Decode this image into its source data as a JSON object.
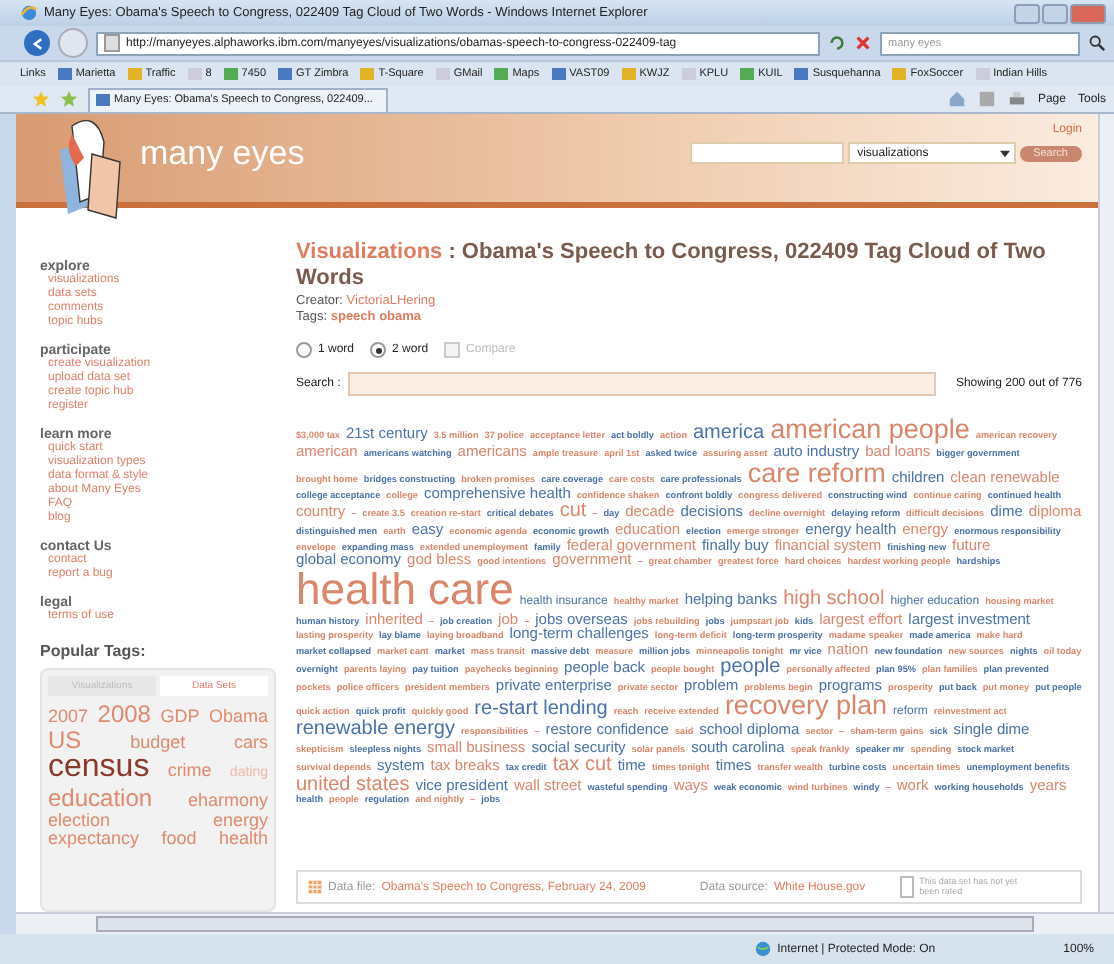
{
  "window": {
    "title": "Many Eyes: Obama's Speech to Congress, 022409 Tag Cloud of Two Words - Windows Internet Explorer"
  },
  "address_bar": {
    "url": "http://manyeyes.alphaworks.ibm.com/manyeyes/visualizations/obamas-speech-to-congress-022409-tag",
    "search_value": "many eyes"
  },
  "links_bar": {
    "label": "Links",
    "items": [
      "Marietta",
      "Traffic",
      "8",
      "7450",
      "GT Zimbra",
      "T-Square",
      "GMail",
      "Maps",
      "VAST09",
      "KWJZ",
      "KPLU",
      "KUIL",
      "Susquehanna",
      "FoxSoccer",
      "Indian Hills"
    ]
  },
  "tab": {
    "title": "Many Eyes: Obama's Speech to Congress, 022409..."
  },
  "commands": [
    "Page",
    "Tools"
  ],
  "site": {
    "name": "many eyes",
    "login": "Login",
    "search_scope": "visualizations",
    "search_button": "Search"
  },
  "sidebar": [
    {
      "heading": "explore",
      "items": [
        "visualizations",
        "data sets",
        "comments",
        "topic hubs"
      ]
    },
    {
      "heading": "participate",
      "items": [
        "create visualization",
        "upload data set",
        "create topic hub",
        "register"
      ]
    },
    {
      "heading": "learn more",
      "items": [
        "quick start",
        "visualization types",
        "data format & style",
        "about Many Eyes",
        "FAQ",
        "blog"
      ]
    },
    {
      "heading": "contact Us",
      "items": [
        "contact",
        "report a bug"
      ]
    },
    {
      "heading": "legal",
      "items": [
        "terms of use"
      ]
    }
  ],
  "popular_tags": {
    "title": "Popular Tags:",
    "tabs": [
      {
        "label": "Visualizations",
        "selected": false
      },
      {
        "label": "Data Sets",
        "selected": true
      }
    ],
    "tags": [
      {
        "text": "2007",
        "kind": "medium"
      },
      {
        "text": "2008",
        "kind": "large"
      },
      {
        "text": "GDP",
        "kind": "medium"
      },
      {
        "text": "Obama",
        "kind": "medium"
      },
      {
        "text": "US",
        "kind": "large"
      },
      {
        "text": "budget",
        "kind": "medium"
      },
      {
        "text": "cars",
        "kind": "medium"
      },
      {
        "text": "census",
        "kind": "huge"
      },
      {
        "text": "crime",
        "kind": "medium"
      },
      {
        "text": "dating",
        "kind": "small"
      },
      {
        "text": "education",
        "kind": "large"
      },
      {
        "text": "eharmony",
        "kind": "medium"
      },
      {
        "text": "election",
        "kind": "medium"
      },
      {
        "text": "energy",
        "kind": "medium"
      },
      {
        "text": "expectancy",
        "kind": "medium"
      },
      {
        "text": "food",
        "kind": "medium"
      },
      {
        "text": "health",
        "kind": "medium"
      }
    ]
  },
  "main": {
    "section": "Visualizations",
    "title": ": Obama's Speech to Congress, 022409 Tag Cloud of Two Words",
    "creator_label": "Creator:",
    "creator": "VictoriaLHering",
    "tags_label": "Tags:",
    "tags": "speech obama",
    "options": [
      {
        "label": "1 word",
        "kind": "radio",
        "selected": false
      },
      {
        "label": "2 word",
        "kind": "radio",
        "selected": true
      },
      {
        "label": "Compare",
        "kind": "checkbox",
        "selected": false,
        "disabled": true
      }
    ],
    "search_label": "Search :",
    "showing": "Showing 200 out of 776",
    "cloud": [
      {
        "text": "$3,000 tax",
        "kind": "tiny",
        "color": "#d9866a"
      },
      {
        "text": "21st century",
        "kind": "medium",
        "color": "#4a72a8"
      },
      {
        "text": "3.5 million",
        "kind": "tiny",
        "color": "#d9866a"
      },
      {
        "text": "37 police",
        "kind": "tiny",
        "color": "#d9866a"
      },
      {
        "text": "acceptance letter",
        "kind": "tiny",
        "color": "#d9866a"
      },
      {
        "text": "act boldly",
        "kind": "tiny",
        "color": "#4a72a8"
      },
      {
        "text": "action",
        "kind": "tiny",
        "color": "#d9866a"
      },
      {
        "text": "america",
        "kind": "large",
        "color": "#4a72a8"
      },
      {
        "text": "american people",
        "kind": "huge",
        "color": "#d9866a"
      },
      {
        "text": "american recovery",
        "kind": "tiny",
        "color": "#d9866a"
      },
      {
        "text": "american",
        "kind": "medium",
        "color": "#d9866a"
      },
      {
        "text": "americans watching",
        "kind": "tiny",
        "color": "#4a72a8"
      },
      {
        "text": "americans",
        "kind": "medium",
        "color": "#d9866a"
      },
      {
        "text": "ample treasure",
        "kind": "tiny",
        "color": "#d9866a"
      },
      {
        "text": "april 1st",
        "kind": "tiny",
        "color": "#d9866a"
      },
      {
        "text": "asked twice",
        "kind": "tiny",
        "color": "#4a72a8"
      },
      {
        "text": "assuring asset",
        "kind": "tiny",
        "color": "#d9866a"
      },
      {
        "text": "auto industry",
        "kind": "medium",
        "color": "#4a72a8"
      },
      {
        "text": "bad loans",
        "kind": "medium",
        "color": "#d9866a"
      },
      {
        "text": "bigger government",
        "kind": "tiny",
        "color": "#4a72a8"
      },
      {
        "text": "brought home",
        "kind": "tiny",
        "color": "#d9866a"
      },
      {
        "text": "bridges constructing",
        "kind": "tiny",
        "color": "#4a72a8"
      },
      {
        "text": "broken promises",
        "kind": "tiny",
        "color": "#d9866a"
      },
      {
        "text": "care coverage",
        "kind": "tiny",
        "color": "#4a72a8"
      },
      {
        "text": "care costs",
        "kind": "tiny",
        "color": "#d9866a"
      },
      {
        "text": "care professionals",
        "kind": "tiny",
        "color": "#4a72a8"
      },
      {
        "text": "care reform",
        "kind": "huge",
        "color": "#d9866a"
      },
      {
        "text": "children",
        "kind": "medium",
        "color": "#4a72a8"
      },
      {
        "text": "clean renewable",
        "kind": "medium",
        "color": "#d9866a"
      },
      {
        "text": "college acceptance",
        "kind": "tiny",
        "color": "#4a72a8"
      },
      {
        "text": "college",
        "kind": "tiny",
        "color": "#d9866a"
      },
      {
        "text": "comprehensive health",
        "kind": "medium",
        "color": "#4a72a8"
      },
      {
        "text": "confidence shaken",
        "kind": "tiny",
        "color": "#d9866a"
      },
      {
        "text": "confront boldly",
        "kind": "tiny",
        "color": "#4a72a8"
      },
      {
        "text": "congress delivered",
        "kind": "tiny",
        "color": "#d9866a"
      },
      {
        "text": "constructing wind",
        "kind": "tiny",
        "color": "#4a72a8"
      },
      {
        "text": "continue caring",
        "kind": "tiny",
        "color": "#d9866a"
      },
      {
        "text": "continued health",
        "kind": "tiny",
        "color": "#4a72a8"
      },
      {
        "text": "country",
        "kind": "medium",
        "color": "#d9866a"
      },
      {
        "text": "–",
        "kind": "tiny",
        "color": "#d9866a"
      },
      {
        "text": "create 3.5",
        "kind": "tiny",
        "color": "#d9866a"
      },
      {
        "text": "creation re-start",
        "kind": "tiny",
        "color": "#d9866a"
      },
      {
        "text": "critical debates",
        "kind": "tiny",
        "color": "#4a72a8"
      },
      {
        "text": "cut",
        "kind": "large",
        "color": "#d9866a"
      },
      {
        "text": "–",
        "kind": "tiny",
        "color": "#d9866a"
      },
      {
        "text": "day",
        "kind": "tiny",
        "color": "#4a72a8"
      },
      {
        "text": "decade",
        "kind": "medium",
        "color": "#d9866a"
      },
      {
        "text": "decisions",
        "kind": "medium",
        "color": "#4a72a8"
      },
      {
        "text": "decline overnight",
        "kind": "tiny",
        "color": "#d9866a"
      },
      {
        "text": "delaying reform",
        "kind": "tiny",
        "color": "#4a72a8"
      },
      {
        "text": "difficult decisions",
        "kind": "tiny",
        "color": "#d9866a"
      },
      {
        "text": "dime",
        "kind": "medium",
        "color": "#4a72a8"
      },
      {
        "text": "diploma",
        "kind": "medium",
        "color": "#d9866a"
      },
      {
        "text": "distinguished men",
        "kind": "tiny",
        "color": "#4a72a8"
      },
      {
        "text": "earth",
        "kind": "tiny",
        "color": "#d9866a"
      },
      {
        "text": "easy",
        "kind": "medium",
        "color": "#4a72a8"
      },
      {
        "text": "economic agenda",
        "kind": "tiny",
        "color": "#d9866a"
      },
      {
        "text": "economic growth",
        "kind": "tiny",
        "color": "#4a72a8"
      },
      {
        "text": "education",
        "kind": "medium",
        "color": "#d9866a"
      },
      {
        "text": "election",
        "kind": "tiny",
        "color": "#4a72a8"
      },
      {
        "text": "emerge stronger",
        "kind": "tiny",
        "color": "#d9866a"
      },
      {
        "text": "energy health",
        "kind": "medium",
        "color": "#4a72a8"
      },
      {
        "text": "energy",
        "kind": "medium",
        "color": "#d9866a"
      },
      {
        "text": "enormous responsibility",
        "kind": "tiny",
        "color": "#4a72a8"
      },
      {
        "text": "envelope",
        "kind": "tiny",
        "color": "#d9866a"
      },
      {
        "text": "expanding mass",
        "kind": "tiny",
        "color": "#4a72a8"
      },
      {
        "text": "extended unemployment",
        "kind": "tiny",
        "color": "#d9866a"
      },
      {
        "text": "family",
        "kind": "tiny",
        "color": "#4a72a8"
      },
      {
        "text": "federal government",
        "kind": "medium",
        "color": "#d9866a"
      },
      {
        "text": "finally buy",
        "kind": "medium",
        "color": "#4a72a8"
      },
      {
        "text": "financial system",
        "kind": "medium",
        "color": "#d9866a"
      },
      {
        "text": "finishing new",
        "kind": "tiny",
        "color": "#4a72a8"
      },
      {
        "text": "future",
        "kind": "medium",
        "color": "#d9866a"
      },
      {
        "text": "global economy",
        "kind": "medium",
        "color": "#4a72a8"
      },
      {
        "text": "god bless",
        "kind": "medium",
        "color": "#d9866a"
      },
      {
        "text": "good intentions",
        "kind": "tiny",
        "color": "#d9866a"
      },
      {
        "text": "government",
        "kind": "medium",
        "color": "#d9866a"
      },
      {
        "text": "–",
        "kind": "tiny",
        "color": "#d9866a"
      },
      {
        "text": "great chamber",
        "kind": "tiny",
        "color": "#d9866a"
      },
      {
        "text": "greatest force",
        "kind": "tiny",
        "color": "#d9866a"
      },
      {
        "text": "hard choices",
        "kind": "tiny",
        "color": "#d9866a"
      },
      {
        "text": "hardest working people",
        "kind": "tiny",
        "color": "#d9866a"
      },
      {
        "text": "hardships",
        "kind": "tiny",
        "color": "#4a72a8"
      },
      {
        "text": "health care",
        "kind": "giant",
        "color": "#d9866a"
      },
      {
        "text": "health insurance",
        "kind": "small",
        "color": "#4a72a8"
      },
      {
        "text": "healthy market",
        "kind": "tiny",
        "color": "#d9866a"
      },
      {
        "text": "helping banks",
        "kind": "medium",
        "color": "#4a72a8"
      },
      {
        "text": "high school",
        "kind": "large",
        "color": "#d9866a"
      },
      {
        "text": "higher education",
        "kind": "small",
        "color": "#4a72a8"
      },
      {
        "text": "housing market",
        "kind": "tiny",
        "color": "#d9866a"
      },
      {
        "text": "human history",
        "kind": "tiny",
        "color": "#4a72a8"
      },
      {
        "text": "inherited",
        "kind": "medium",
        "color": "#d9866a"
      },
      {
        "text": "–",
        "kind": "tiny",
        "color": "#d9866a"
      },
      {
        "text": "job creation",
        "kind": "tiny",
        "color": "#4a72a8"
      },
      {
        "text": "job",
        "kind": "medium",
        "color": "#d9866a"
      },
      {
        "text": "–",
        "kind": "tiny",
        "color": "#d9866a"
      },
      {
        "text": "jobs overseas",
        "kind": "medium",
        "color": "#4a72a8"
      },
      {
        "text": "jobs rebuilding",
        "kind": "tiny",
        "color": "#d9866a"
      },
      {
        "text": "jobs",
        "kind": "tiny",
        "color": "#4a72a8"
      },
      {
        "text": "jumpstart job",
        "kind": "tiny",
        "color": "#d9866a"
      },
      {
        "text": "kids",
        "kind": "tiny",
        "color": "#4a72a8"
      },
      {
        "text": "largest effort",
        "kind": "medium",
        "color": "#d9866a"
      },
      {
        "text": "largest investment",
        "kind": "medium",
        "color": "#4a72a8"
      },
      {
        "text": "lasting prosperity",
        "kind": "tiny",
        "color": "#d9866a"
      },
      {
        "text": "lay blame",
        "kind": "tiny",
        "color": "#4a72a8"
      },
      {
        "text": "laying broadband",
        "kind": "tiny",
        "color": "#d9866a"
      },
      {
        "text": "long-term challenges",
        "kind": "medium",
        "color": "#4a72a8"
      },
      {
        "text": "long-term deficit",
        "kind": "tiny",
        "color": "#d9866a"
      },
      {
        "text": "long-term prosperity",
        "kind": "tiny",
        "color": "#4a72a8"
      },
      {
        "text": "madame speaker",
        "kind": "tiny",
        "color": "#d9866a"
      },
      {
        "text": "made america",
        "kind": "tiny",
        "color": "#4a72a8"
      },
      {
        "text": "make hard",
        "kind": "tiny",
        "color": "#d9866a"
      },
      {
        "text": "market collapsed",
        "kind": "tiny",
        "color": "#4a72a8"
      },
      {
        "text": "market cant",
        "kind": "tiny",
        "color": "#d9866a"
      },
      {
        "text": "market",
        "kind": "tiny",
        "color": "#4a72a8"
      },
      {
        "text": "mass transit",
        "kind": "tiny",
        "color": "#d9866a"
      },
      {
        "text": "massive debt",
        "kind": "tiny",
        "color": "#4a72a8"
      },
      {
        "text": "measure",
        "kind": "tiny",
        "color": "#d9866a"
      },
      {
        "text": "million jobs",
        "kind": "tiny",
        "color": "#4a72a8"
      },
      {
        "text": "minneapolis tonight",
        "kind": "tiny",
        "color": "#d9866a"
      },
      {
        "text": "mr vice",
        "kind": "tiny",
        "color": "#4a72a8"
      },
      {
        "text": "nation",
        "kind": "medium",
        "color": "#d9866a"
      },
      {
        "text": "new foundation",
        "kind": "tiny",
        "color": "#4a72a8"
      },
      {
        "text": "new sources",
        "kind": "tiny",
        "color": "#d9866a"
      },
      {
        "text": "nights",
        "kind": "tiny",
        "color": "#4a72a8"
      },
      {
        "text": "oil today",
        "kind": "tiny",
        "color": "#d9866a"
      },
      {
        "text": "overnight",
        "kind": "tiny",
        "color": "#4a72a8"
      },
      {
        "text": "parents laying",
        "kind": "tiny",
        "color": "#d9866a"
      },
      {
        "text": "pay tuition",
        "kind": "tiny",
        "color": "#4a72a8"
      },
      {
        "text": "paychecks beginning",
        "kind": "tiny",
        "color": "#d9866a"
      },
      {
        "text": "people back",
        "kind": "medium",
        "color": "#4a72a8"
      },
      {
        "text": "people bought",
        "kind": "tiny",
        "color": "#d9866a"
      },
      {
        "text": "people",
        "kind": "large",
        "color": "#4a72a8"
      },
      {
        "text": "personally affected",
        "kind": "tiny",
        "color": "#d9866a"
      },
      {
        "text": "plan 95%",
        "kind": "tiny",
        "color": "#4a72a8"
      },
      {
        "text": "plan families",
        "kind": "tiny",
        "color": "#d9866a"
      },
      {
        "text": "plan prevented",
        "kind": "tiny",
        "color": "#4a72a8"
      },
      {
        "text": "pockets",
        "kind": "tiny",
        "color": "#d9866a"
      },
      {
        "text": "police officers",
        "kind": "tiny",
        "color": "#d9866a"
      },
      {
        "text": "president members",
        "kind": "tiny",
        "color": "#d9866a"
      },
      {
        "text": "private enterprise",
        "kind": "medium",
        "color": "#4a72a8"
      },
      {
        "text": "private sector",
        "kind": "tiny",
        "color": "#d9866a"
      },
      {
        "text": "problem",
        "kind": "medium",
        "color": "#4a72a8"
      },
      {
        "text": "problems begin",
        "kind": "tiny",
        "color": "#d9866a"
      },
      {
        "text": "programs",
        "kind": "medium",
        "color": "#4a72a8"
      },
      {
        "text": "prosperity",
        "kind": "tiny",
        "color": "#d9866a"
      },
      {
        "text": "put back",
        "kind": "tiny",
        "color": "#4a72a8"
      },
      {
        "text": "put money",
        "kind": "tiny",
        "color": "#d9866a"
      },
      {
        "text": "put people",
        "kind": "tiny",
        "color": "#4a72a8"
      },
      {
        "text": "quick action",
        "kind": "tiny",
        "color": "#d9866a"
      },
      {
        "text": "quick profit",
        "kind": "tiny",
        "color": "#4a72a8"
      },
      {
        "text": "quickly good",
        "kind": "tiny",
        "color": "#d9866a"
      },
      {
        "text": "re-start lending",
        "kind": "large",
        "color": "#4a72a8"
      },
      {
        "text": "reach",
        "kind": "tiny",
        "color": "#d9866a"
      },
      {
        "text": "receive extended",
        "kind": "tiny",
        "color": "#d9866a"
      },
      {
        "text": "recovery plan",
        "kind": "huge",
        "color": "#d9866a"
      },
      {
        "text": "reform",
        "kind": "small",
        "color": "#4a72a8"
      },
      {
        "text": "reinvestment act",
        "kind": "tiny",
        "color": "#d9866a"
      },
      {
        "text": "renewable energy",
        "kind": "large",
        "color": "#4a72a8"
      },
      {
        "text": "responsibilities",
        "kind": "tiny",
        "color": "#d9866a"
      },
      {
        "text": "–",
        "kind": "tiny",
        "color": "#d9866a"
      },
      {
        "text": "restore confidence",
        "kind": "medium",
        "color": "#4a72a8"
      },
      {
        "text": "said",
        "kind": "tiny",
        "color": "#d9866a"
      },
      {
        "text": "school diploma",
        "kind": "medium",
        "color": "#4a72a8"
      },
      {
        "text": "sector",
        "kind": "tiny",
        "color": "#d9866a"
      },
      {
        "text": "–",
        "kind": "tiny",
        "color": "#d9866a"
      },
      {
        "text": "sham-term gains",
        "kind": "tiny",
        "color": "#d9866a"
      },
      {
        "text": "sick",
        "kind": "tiny",
        "color": "#4a72a8"
      },
      {
        "text": "single dime",
        "kind": "medium",
        "color": "#4a72a8"
      },
      {
        "text": "skepticism",
        "kind": "tiny",
        "color": "#d9866a"
      },
      {
        "text": "sleepless nights",
        "kind": "tiny",
        "color": "#4a72a8"
      },
      {
        "text": "small business",
        "kind": "medium",
        "color": "#d9866a"
      },
      {
        "text": "social security",
        "kind": "medium",
        "color": "#4a72a8"
      },
      {
        "text": "solar panels",
        "kind": "tiny",
        "color": "#d9866a"
      },
      {
        "text": "south carolina",
        "kind": "medium",
        "color": "#4a72a8"
      },
      {
        "text": "speak frankly",
        "kind": "tiny",
        "color": "#d9866a"
      },
      {
        "text": "speaker mr",
        "kind": "tiny",
        "color": "#4a72a8"
      },
      {
        "text": "spending",
        "kind": "tiny",
        "color": "#d9866a"
      },
      {
        "text": "stock market",
        "kind": "tiny",
        "color": "#4a72a8"
      },
      {
        "text": "survival depends",
        "kind": "tiny",
        "color": "#d9866a"
      },
      {
        "text": "system",
        "kind": "medium",
        "color": "#4a72a8"
      },
      {
        "text": "tax breaks",
        "kind": "medium",
        "color": "#d9866a"
      },
      {
        "text": "tax credit",
        "kind": "tiny",
        "color": "#4a72a8"
      },
      {
        "text": "tax cut",
        "kind": "large",
        "color": "#d9866a"
      },
      {
        "text": "time",
        "kind": "medium",
        "color": "#4a72a8"
      },
      {
        "text": "times tonight",
        "kind": "tiny",
        "color": "#d9866a"
      },
      {
        "text": "times",
        "kind": "medium",
        "color": "#4a72a8"
      },
      {
        "text": "transfer wealth",
        "kind": "tiny",
        "color": "#d9866a"
      },
      {
        "text": "turbine costs",
        "kind": "tiny",
        "color": "#4a72a8"
      },
      {
        "text": "uncertain times",
        "kind": "tiny",
        "color": "#d9866a"
      },
      {
        "text": "unemployment benefits",
        "kind": "tiny",
        "color": "#4a72a8"
      },
      {
        "text": "united states",
        "kind": "large",
        "color": "#d9866a"
      },
      {
        "text": "vice president",
        "kind": "medium",
        "color": "#4a72a8"
      },
      {
        "text": "wall street",
        "kind": "medium",
        "color": "#d9866a"
      },
      {
        "text": "wasteful spending",
        "kind": "tiny",
        "color": "#4a72a8"
      },
      {
        "text": "ways",
        "kind": "medium",
        "color": "#d9866a"
      },
      {
        "text": "weak economic",
        "kind": "tiny",
        "color": "#4a72a8"
      },
      {
        "text": "wind turbines",
        "kind": "tiny",
        "color": "#d9866a"
      },
      {
        "text": "windy",
        "kind": "tiny",
        "color": "#4a72a8"
      },
      {
        "text": "–",
        "kind": "tiny",
        "color": "#d9866a"
      },
      {
        "text": "work",
        "kind": "medium",
        "color": "#d9866a"
      },
      {
        "text": "working households",
        "kind": "tiny",
        "color": "#4a72a8"
      },
      {
        "text": "years",
        "kind": "medium",
        "color": "#d9866a"
      },
      {
        "text": "health",
        "kind": "tiny",
        "color": "#4a72a8"
      },
      {
        "text": "people",
        "kind": "tiny",
        "color": "#d9866a"
      },
      {
        "text": "regulation",
        "kind": "tiny",
        "color": "#4a72a8"
      },
      {
        "text": "and nightly",
        "kind": "tiny",
        "color": "#d9866a"
      },
      {
        "text": "–",
        "kind": "tiny",
        "color": "#d9866a"
      },
      {
        "text": "jobs",
        "kind": "tiny",
        "color": "#4a72a8"
      }
    ],
    "data_file_label": "Data file:",
    "data_file": "Obama's Speech to Congress, February 24, 2009",
    "data_source_label": "Data source:",
    "data_source": "White House.gov",
    "rating": "This data set has not yet been rated"
  },
  "status_bar": {
    "zone": "Internet | Protected Mode: On",
    "zoom": "100%"
  }
}
